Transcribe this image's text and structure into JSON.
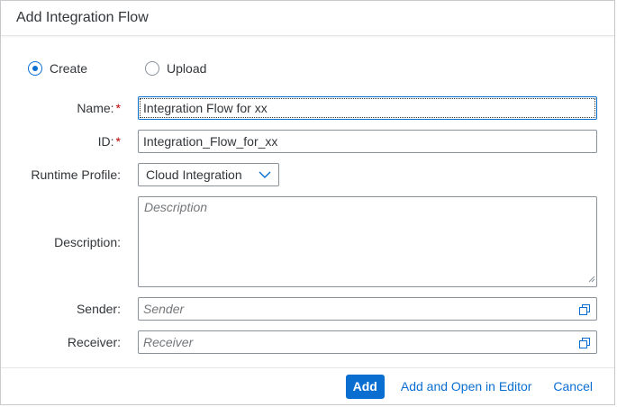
{
  "dialog": {
    "title": "Add Integration Flow"
  },
  "mode": {
    "options": [
      {
        "label": "Create",
        "selected": true
      },
      {
        "label": "Upload",
        "selected": false
      }
    ]
  },
  "form": {
    "name": {
      "label": "Name:",
      "required_marker": "*",
      "value": "Integration Flow for xx"
    },
    "id": {
      "label": "ID:",
      "required_marker": "*",
      "value": "Integration_Flow_for_xx"
    },
    "runtime_profile": {
      "label": "Runtime Profile:",
      "value": "Cloud Integration"
    },
    "description": {
      "label": "Description:",
      "placeholder": "Description"
    },
    "sender": {
      "label": "Sender:",
      "placeholder": "Sender",
      "icon": "value-help-icon"
    },
    "receiver": {
      "label": "Receiver:",
      "placeholder": "Receiver",
      "icon": "value-help-icon"
    }
  },
  "footer": {
    "add_label": "Add",
    "add_open_label": "Add and Open in Editor",
    "cancel_label": "Cancel"
  },
  "colors": {
    "accent": "#0a6ed1",
    "required": "#bb0000",
    "border": "#89919a"
  }
}
